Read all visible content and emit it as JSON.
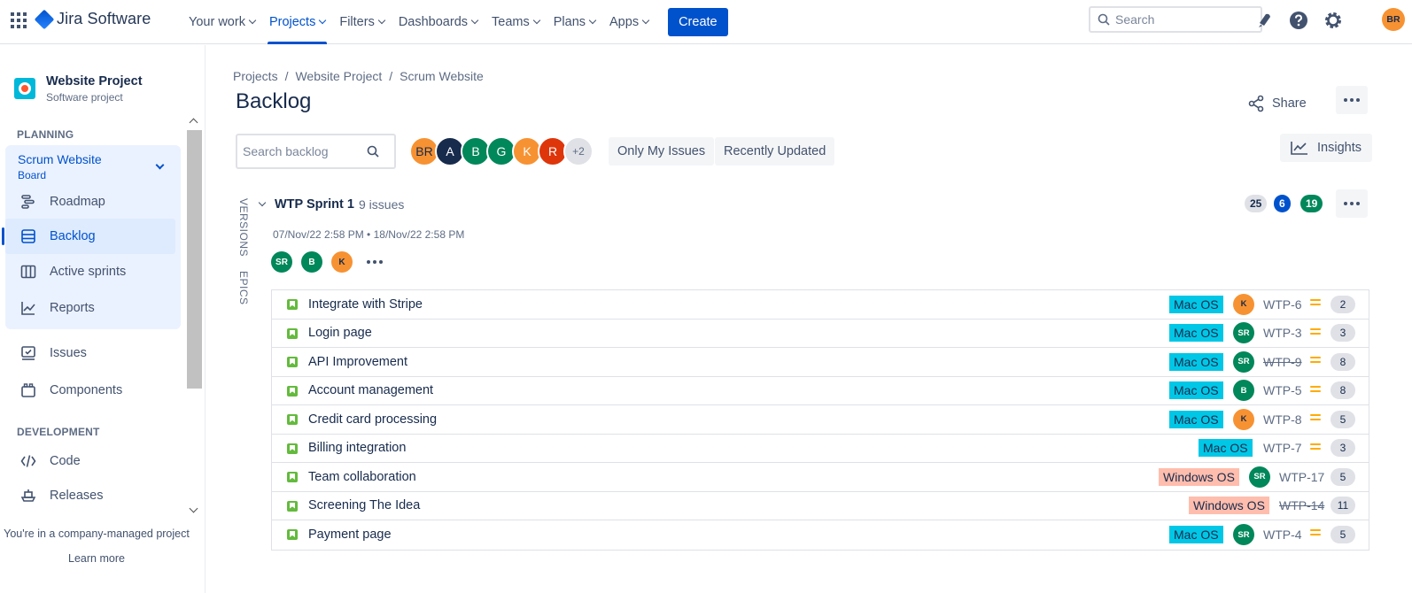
{
  "nav": {
    "product": "Jira Software",
    "items": [
      {
        "label": "Your work",
        "active": false
      },
      {
        "label": "Projects",
        "active": true
      },
      {
        "label": "Filters",
        "active": false
      },
      {
        "label": "Dashboards",
        "active": false
      },
      {
        "label": "Teams",
        "active": false
      },
      {
        "label": "Plans",
        "active": false
      },
      {
        "label": "Apps",
        "active": false
      }
    ],
    "create_label": "Create",
    "search_placeholder": "Search",
    "user_initials": "BR",
    "icons": [
      "bell-rocket-icon",
      "help-icon",
      "settings-icon"
    ]
  },
  "sidebar": {
    "project_name": "Website Project",
    "project_type": "Software project",
    "planning_label": "PLANNING",
    "board_name": "Scrum Website",
    "board_sub": "Board",
    "planning_items": [
      {
        "label": "Roadmap",
        "icon": "roadmap-icon"
      },
      {
        "label": "Backlog",
        "icon": "backlog-icon",
        "active": true
      },
      {
        "label": "Active sprints",
        "icon": "board-columns-icon"
      },
      {
        "label": "Reports",
        "icon": "reports-chart-icon"
      }
    ],
    "other_items": [
      {
        "label": "Issues",
        "icon": "issues-icon"
      },
      {
        "label": "Components",
        "icon": "components-icon"
      }
    ],
    "development_label": "DEVELOPMENT",
    "dev_items": [
      {
        "label": "Code",
        "icon": "code-icon"
      },
      {
        "label": "Releases",
        "icon": "releases-icon"
      }
    ],
    "footer_note": "You're in a company-managed project",
    "footer_link": "Learn more"
  },
  "main": {
    "breadcrumb": [
      "Projects",
      "Website Project",
      "Scrum Website"
    ],
    "title": "Backlog",
    "share_label": "Share",
    "search_placeholder": "Search backlog",
    "avatars": [
      {
        "initials": "BR",
        "color": "#F79232",
        "text": "#172B4D"
      },
      {
        "initials": "A",
        "color": "#172B4D",
        "text": "#ffffff"
      },
      {
        "initials": "B",
        "color": "#00875A",
        "text": "#ffffff"
      },
      {
        "initials": "G",
        "color": "#00875A",
        "text": "#ffffff"
      },
      {
        "initials": "K",
        "color": "#F79232",
        "text": "#ffffff"
      },
      {
        "initials": "R",
        "color": "#DE350B",
        "text": "#ffffff"
      },
      {
        "initials": "+2",
        "color": "#DFE1E6",
        "text": "#5E6C84"
      }
    ],
    "filters": [
      "Only My Issues",
      "Recently Updated"
    ],
    "insights_label": "Insights",
    "vertical_tabs": [
      "VERSIONS",
      "EPICS"
    ]
  },
  "sprint": {
    "name": "WTP Sprint 1",
    "count": "9 issues",
    "dates": "07/Nov/22 2:58 PM  •  18/Nov/22 2:58 PM",
    "assignees": [
      {
        "initials": "SR",
        "color": "#00875A"
      },
      {
        "initials": "B",
        "color": "#00875A"
      },
      {
        "initials": "K",
        "color": "#F79232"
      }
    ],
    "status_counts": [
      {
        "value": "25",
        "bg": "#DFE1E6",
        "fg": "#172B4D"
      },
      {
        "value": "6",
        "bg": "#0052CC",
        "fg": "#ffffff"
      },
      {
        "value": "19",
        "bg": "#00875A",
        "fg": "#ffffff"
      }
    ]
  },
  "issues": [
    {
      "summary": "Integrate with Stripe",
      "label": "Mac OS",
      "assignee": "K",
      "key": "WTP-6",
      "done": false,
      "priority": true,
      "points": "2"
    },
    {
      "summary": "Login page",
      "label": "Mac OS",
      "assignee": "SR",
      "key": "WTP-3",
      "done": false,
      "priority": true,
      "points": "3"
    },
    {
      "summary": "API Improvement",
      "label": "Mac OS",
      "assignee": "SR",
      "key": "WTP-9",
      "done": true,
      "priority": true,
      "points": "8"
    },
    {
      "summary": "Account management",
      "label": "Mac OS",
      "assignee": "B",
      "key": "WTP-5",
      "done": false,
      "priority": true,
      "points": "8"
    },
    {
      "summary": "Credit card processing",
      "label": "Mac OS",
      "assignee": "K",
      "key": "WTP-8",
      "done": false,
      "priority": true,
      "points": "5"
    },
    {
      "summary": "Billing integration",
      "label": "Mac OS",
      "assignee": "",
      "key": "WTP-7",
      "done": false,
      "priority": true,
      "points": "3"
    },
    {
      "summary": "Team collaboration",
      "label": "Windows OS",
      "assignee": "SR",
      "key": "WTP-17",
      "done": false,
      "priority": false,
      "points": "5"
    },
    {
      "summary": "Screening The Idea",
      "label": "Windows OS",
      "assignee": "",
      "key": "WTP-14",
      "done": true,
      "priority": false,
      "points": "11"
    },
    {
      "summary": "Payment page",
      "label": "Mac OS",
      "assignee": "SR",
      "key": "WTP-4",
      "done": false,
      "priority": true,
      "points": "5"
    }
  ],
  "colors": {
    "accent": "#0052CC",
    "mac_label_bg": "#00C7E6",
    "windows_label_bg": "#FFBDAD",
    "priority_medium": "#FFAB00",
    "story": "#63BA3C"
  }
}
